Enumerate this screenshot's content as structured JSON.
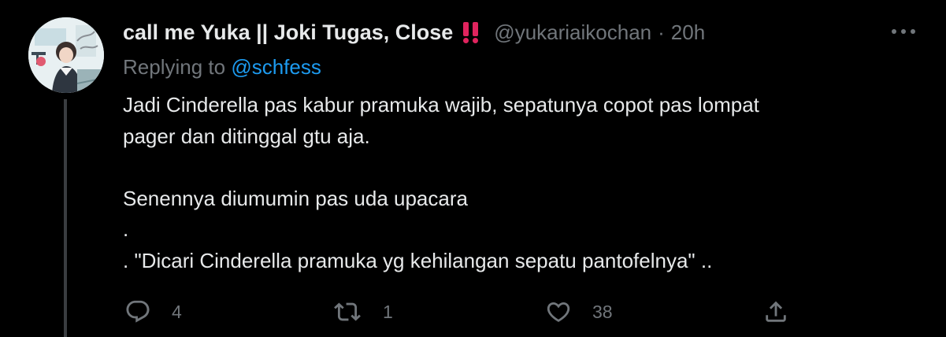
{
  "tweet": {
    "display_name": "call me Yuka || Joki Tugas, Close",
    "display_name_emoji": "double-exclamation-icon",
    "handle": "@yukariaikochan",
    "separator": "·",
    "time": "20h",
    "replying_prefix": "Replying to",
    "replying_to": "@schfess",
    "body_lines": [
      "Jadi Cinderella pas kabur pramuka wajib, sepatunya copot pas lompat",
      "pager dan ditinggal gtu aja.",
      "",
      "Senennya diumumin pas uda upacara",
      ".",
      ". \"Dicari Cinderella pramuka yg kehilangan sepatu pantofelnya\" .."
    ],
    "actions": {
      "reply_count": "4",
      "retweet_count": "1",
      "like_count": "38"
    }
  },
  "colors": {
    "background": "#000000",
    "primary_text": "#e7e9ea",
    "secondary_text": "#71767b",
    "link": "#1d9bf0",
    "thread_line": "#3a3d40",
    "emoji_red": "#e0245e"
  },
  "icons": {
    "more": "more-horizontal-icon",
    "reply": "reply-icon",
    "retweet": "retweet-icon",
    "like": "heart-icon",
    "share": "share-icon"
  }
}
